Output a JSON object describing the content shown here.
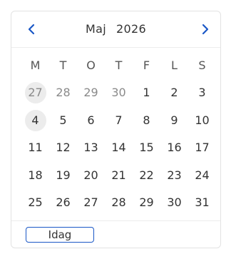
{
  "header": {
    "month": "Maj",
    "year": "2026",
    "prev_icon": "chevron-left-icon",
    "next_icon": "chevron-right-icon"
  },
  "weekdays": [
    "M",
    "T",
    "O",
    "T",
    "F",
    "L",
    "S"
  ],
  "weeks": [
    [
      {
        "label": "27",
        "other": true,
        "highlight": true
      },
      {
        "label": "28",
        "other": true
      },
      {
        "label": "29",
        "other": true
      },
      {
        "label": "30",
        "other": true
      },
      {
        "label": "1"
      },
      {
        "label": "2"
      },
      {
        "label": "3"
      }
    ],
    [
      {
        "label": "4",
        "highlight": true
      },
      {
        "label": "5"
      },
      {
        "label": "6"
      },
      {
        "label": "7"
      },
      {
        "label": "8"
      },
      {
        "label": "9"
      },
      {
        "label": "10"
      }
    ],
    [
      {
        "label": "11"
      },
      {
        "label": "12"
      },
      {
        "label": "13"
      },
      {
        "label": "14"
      },
      {
        "label": "15"
      },
      {
        "label": "16"
      },
      {
        "label": "17"
      }
    ],
    [
      {
        "label": "18"
      },
      {
        "label": "19"
      },
      {
        "label": "20"
      },
      {
        "label": "21"
      },
      {
        "label": "22"
      },
      {
        "label": "23"
      },
      {
        "label": "24"
      }
    ],
    [
      {
        "label": "25"
      },
      {
        "label": "26"
      },
      {
        "label": "27"
      },
      {
        "label": "28"
      },
      {
        "label": "29"
      },
      {
        "label": "30"
      },
      {
        "label": "31"
      }
    ]
  ],
  "footer": {
    "today_label": "Idag"
  },
  "colors": {
    "accent": "#1a57c6",
    "highlight_bg": "#ececec",
    "other_month_text": "#8a8a8a",
    "text": "#333333"
  }
}
